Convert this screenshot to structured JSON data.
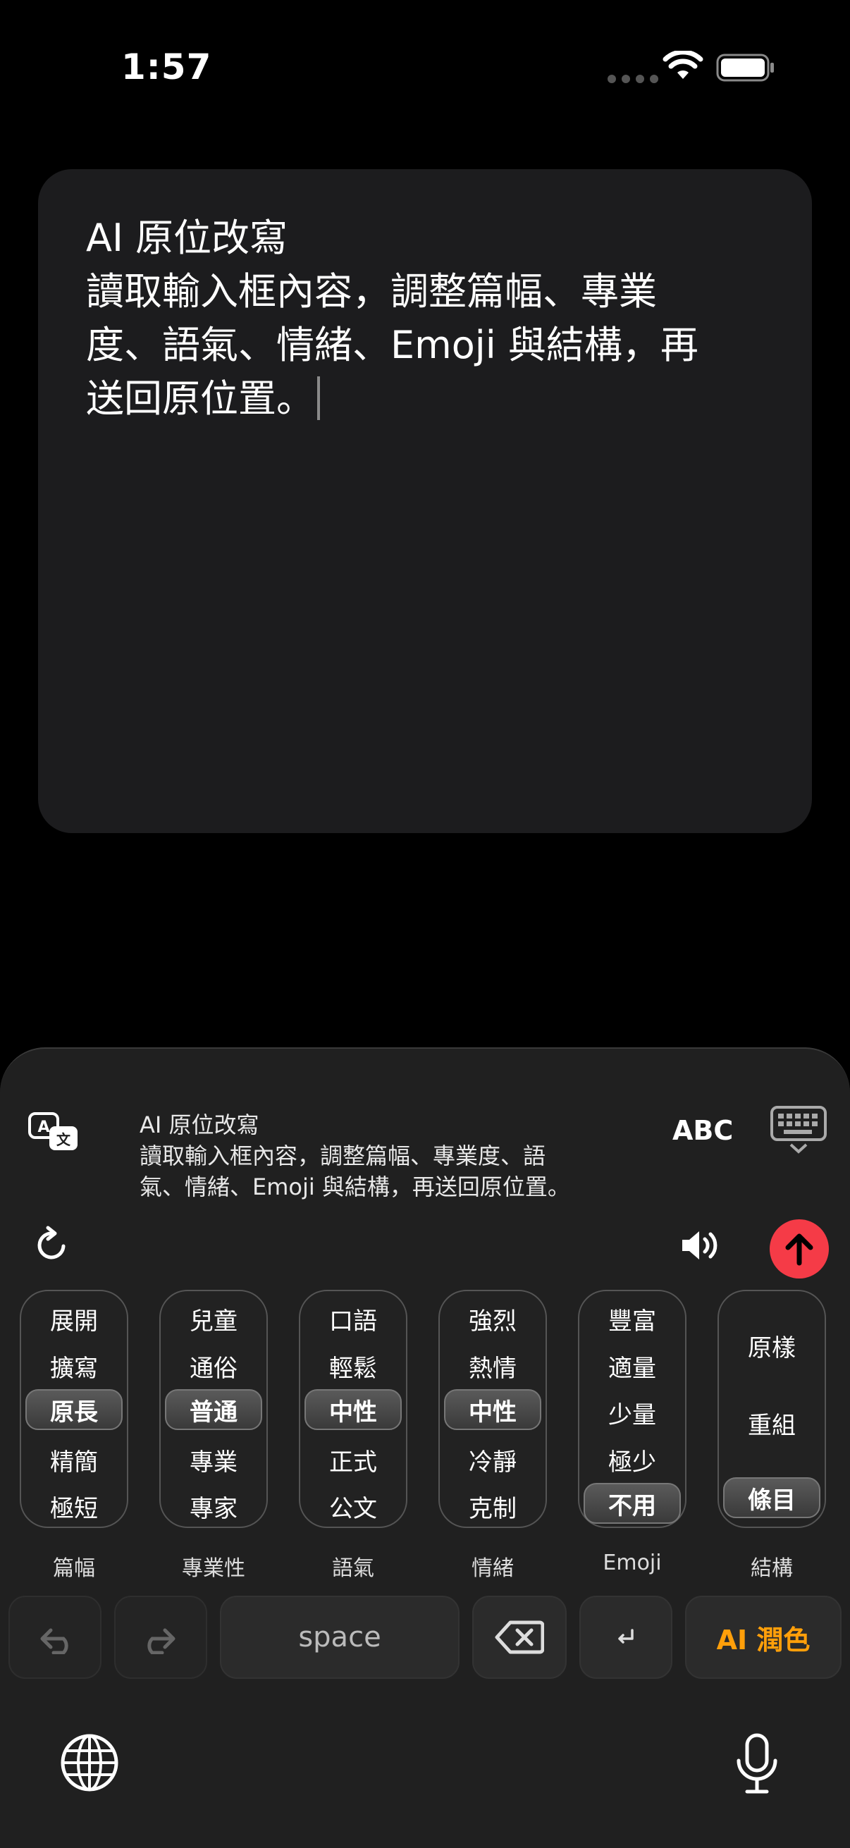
{
  "status": {
    "time": "1:57"
  },
  "editor": {
    "text": "AI 原位改寫\n讀取輸入框內容，調整篇幅、專業\n度、語氣、情緒、Emoji 與結構，再\n送回原位置。"
  },
  "keyboard": {
    "preview_text": "AI 原位改寫\n讀取輸入框內容，調整篇幅、專業度、語\n氣、情緒、Emoji 與結構，再送回原位置。",
    "abc_label": "ABC",
    "wheels": [
      {
        "label": "篇幅",
        "options": [
          "展開",
          "擴寫",
          "原長",
          "精簡",
          "極短"
        ],
        "selected": "原長"
      },
      {
        "label": "專業性",
        "options": [
          "兒童",
          "通俗",
          "普通",
          "專業",
          "專家"
        ],
        "selected": "普通"
      },
      {
        "label": "語氣",
        "options": [
          "口語",
          "輕鬆",
          "中性",
          "正式",
          "公文"
        ],
        "selected": "中性"
      },
      {
        "label": "情緒",
        "options": [
          "強烈",
          "熱情",
          "中性",
          "冷靜",
          "克制"
        ],
        "selected": "中性"
      },
      {
        "label": "Emoji",
        "options": [
          "豐富",
          "適量",
          "少量",
          "極少",
          "不用"
        ],
        "selected": "不用"
      },
      {
        "label": "結構",
        "options": [
          "原樣",
          "重組",
          "條目"
        ],
        "selected": "條目"
      }
    ],
    "keys": {
      "space": "space",
      "ai_polish": "AI 潤色"
    }
  },
  "colors": {
    "accent": "#ff9f0a",
    "send": "#f53b47"
  }
}
